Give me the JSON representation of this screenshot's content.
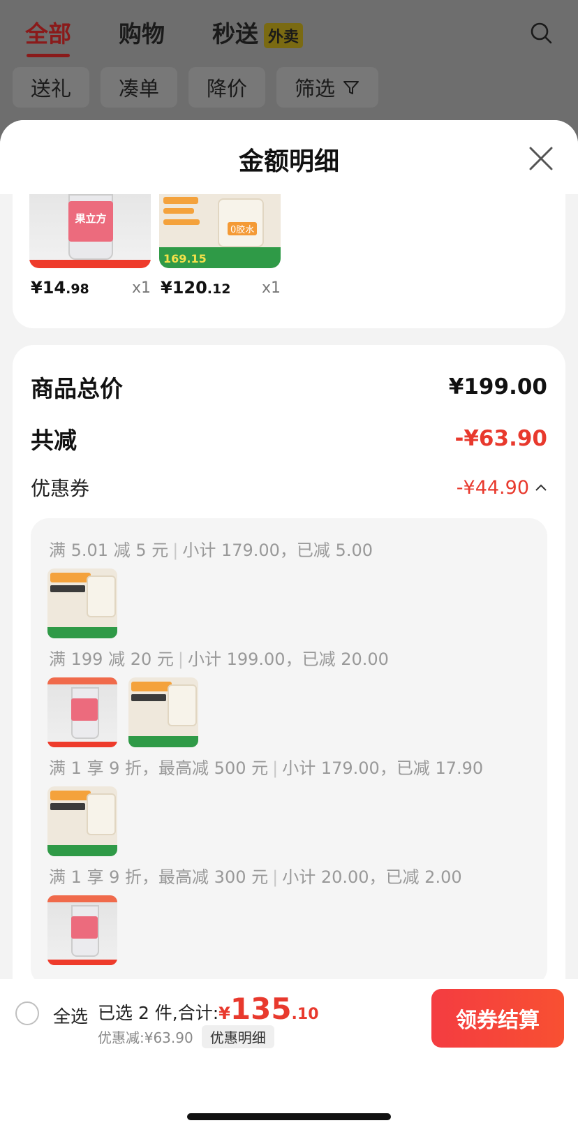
{
  "header": {
    "tabs": [
      {
        "label": "全部",
        "active": true
      },
      {
        "label": "购物",
        "active": false
      },
      {
        "label": "秒送",
        "active": false,
        "badge": "外卖"
      }
    ],
    "filters": [
      "送礼",
      "凑单",
      "降价",
      "筛选"
    ]
  },
  "sheet": {
    "title": "金额明细",
    "products": [
      {
        "price_int": "¥14",
        "price_dec": ".98",
        "qty": "x1",
        "image": "pink-drink-bottle",
        "image_text": "果立方"
      },
      {
        "price_int": "¥120",
        "price_dec": ".12",
        "qty": "x1",
        "image": "glass-kettle",
        "image_text": "0胶水",
        "image_price": "169.15"
      }
    ],
    "summary": {
      "total_label": "商品总价",
      "total_value": "¥199.00",
      "discount_label": "共减",
      "discount_value": "-¥63.90",
      "coupon_label": "优惠券",
      "coupon_value": "-¥44.90"
    },
    "coupon_rules": [
      {
        "text": "满 5.01 减 5 元",
        "sub": "小计 179.00，已减 5.00"
      },
      {
        "text": "满 199 减 20 元",
        "sub": "小计 199.00，已减 20.00"
      },
      {
        "text": "满 1 享 9 折，最高减 500 元",
        "sub": "小计 179.00，已减 17.90"
      },
      {
        "text": "满 1 享 9 折，最高减 300 元",
        "sub": "小计 20.00，已减 2.00"
      }
    ]
  },
  "bottom_bar": {
    "select_all": "全选",
    "selected_text": "已选 2 件,合计:",
    "total_symbol": "¥",
    "total_int": "135",
    "total_dec": ".10",
    "discount_text": "优惠减:¥63.90",
    "detail_link": "优惠明细",
    "checkout_button": "领券结算"
  },
  "colors": {
    "accent_red": "#e8392d",
    "checkout_start": "#f43c41",
    "checkout_end": "#f85032"
  }
}
